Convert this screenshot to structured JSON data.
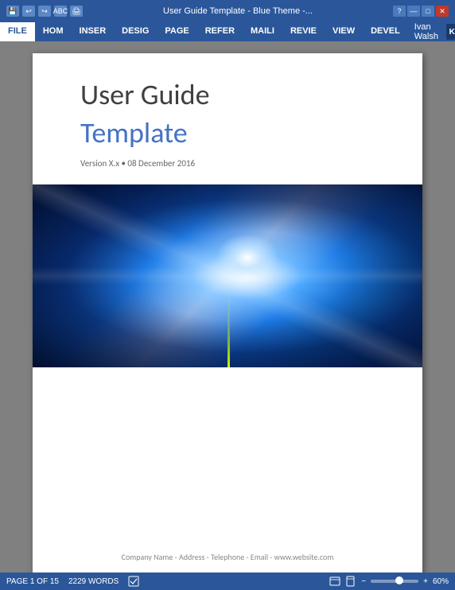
{
  "titlebar": {
    "text": "User Guide Template - Blue Theme -...",
    "help_icon": "?",
    "min_icon": "—",
    "max_icon": "□",
    "close_icon": "✕"
  },
  "ribbon": {
    "tabs": [
      {
        "label": "FILE",
        "active": true
      },
      {
        "label": "HOM",
        "active": false
      },
      {
        "label": "INSER",
        "active": false
      },
      {
        "label": "DESIG",
        "active": false
      },
      {
        "label": "PAGE",
        "active": false
      },
      {
        "label": "REFER",
        "active": false
      },
      {
        "label": "MAILI",
        "active": false
      },
      {
        "label": "REVIE",
        "active": false
      },
      {
        "label": "VIEW",
        "active": false
      },
      {
        "label": "DEVEL",
        "active": false
      }
    ],
    "user_name": "Ivan Walsh",
    "user_initial": "K"
  },
  "document": {
    "title_main": "User Guide",
    "title_sub": "Template",
    "version": "Version X.x • 08 December 2016",
    "company_info": "Company Name - Address - Telephone - Email - www.website.com"
  },
  "statusbar": {
    "page": "PAGE 1 OF 15",
    "words": "2229 WORDS",
    "zoom_percent": "60%",
    "icons": [
      "doc-icon",
      "layout-icon"
    ]
  }
}
